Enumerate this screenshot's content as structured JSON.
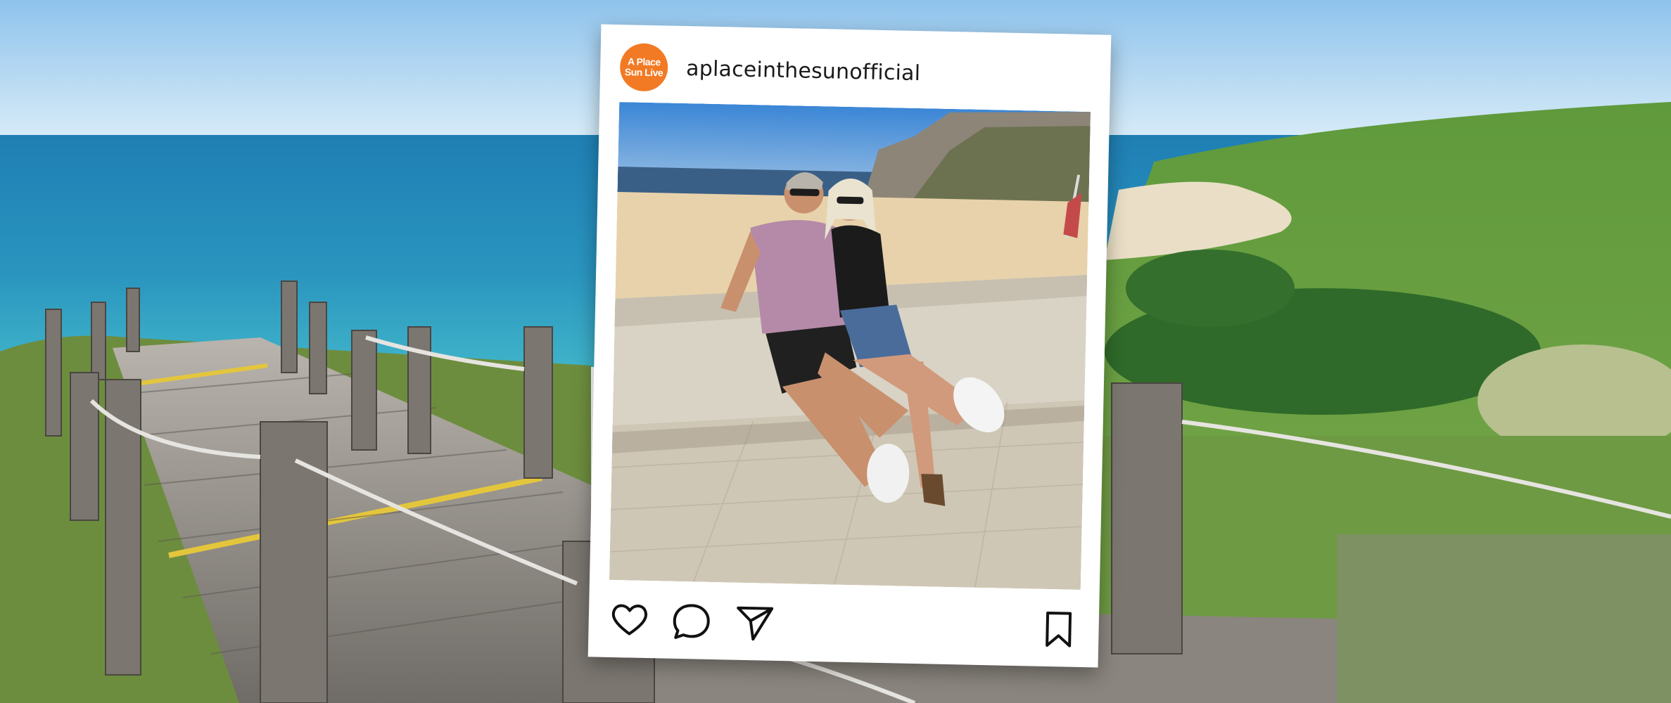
{
  "post": {
    "username": "aplaceinthesunofficial",
    "avatar_text_line1": "A Place",
    "avatar_text_line2": "Sun Live",
    "avatar_color": "#f27a24"
  },
  "icons": {
    "like": "heart-icon",
    "comment": "comment-bubble-icon",
    "share": "paper-plane-icon",
    "save": "bookmark-icon"
  }
}
